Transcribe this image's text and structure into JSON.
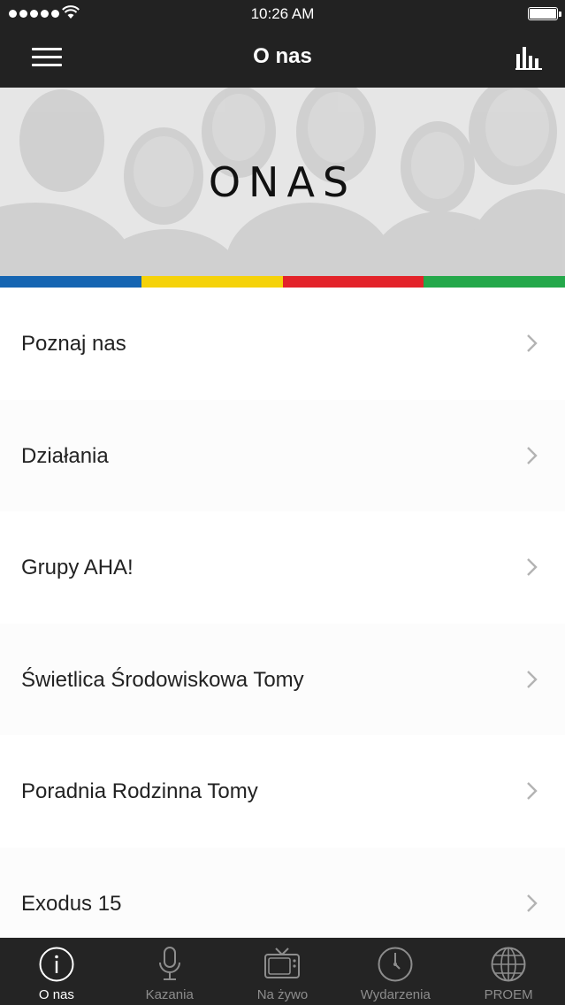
{
  "status_bar": {
    "time": "10:26 AM"
  },
  "nav_bar": {
    "title": "O nas"
  },
  "hero": {
    "heading": "ONAS"
  },
  "stripe_colors": [
    "#1565b2",
    "#f5d20a",
    "#e3232a",
    "#24a84a"
  ],
  "menu_items": [
    {
      "label": "Poznaj nas"
    },
    {
      "label": "Działania"
    },
    {
      "label": "Grupy AHA!"
    },
    {
      "label": "Świetlica Środowiskowa Tomy"
    },
    {
      "label": "Poradnia Rodzinna Tomy"
    },
    {
      "label": "Exodus 15"
    }
  ],
  "tab_bar": {
    "tabs": [
      {
        "label": "O nas",
        "icon": "info-icon",
        "active": true
      },
      {
        "label": "Kazania",
        "icon": "microphone-icon",
        "active": false
      },
      {
        "label": "Na żywo",
        "icon": "tv-icon",
        "active": false
      },
      {
        "label": "Wydarzenia",
        "icon": "clock-icon",
        "active": false
      },
      {
        "label": "PROEM",
        "icon": "globe-icon",
        "active": false
      }
    ]
  }
}
